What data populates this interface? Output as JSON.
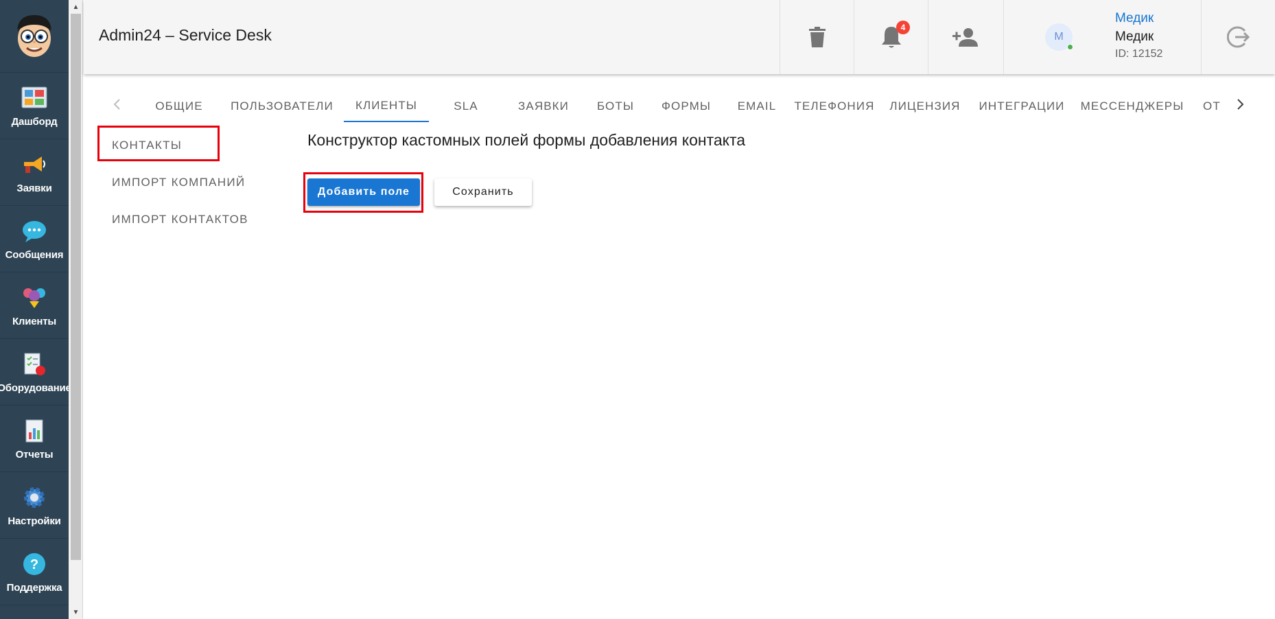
{
  "sidebar": {
    "items": [
      {
        "label": "Дашборд",
        "icon": "dashboard-icon"
      },
      {
        "label": "Заявки",
        "icon": "megaphone-icon"
      },
      {
        "label": "Сообщения",
        "icon": "chat-bubble-icon"
      },
      {
        "label": "Клиенты",
        "icon": "clients-icon"
      },
      {
        "label": "Оборудование",
        "icon": "equipment-icon"
      },
      {
        "label": "Отчеты",
        "icon": "reports-icon"
      },
      {
        "label": "Настройки",
        "icon": "gear-icon"
      },
      {
        "label": "Поддержка",
        "icon": "help-icon"
      }
    ]
  },
  "header": {
    "title": "Admin24 – Service Desk",
    "notifications_count": "4",
    "user": {
      "link": "Медик",
      "name": "Медик",
      "id": "ID: 12152",
      "avatar_letter": "М"
    }
  },
  "tabs": [
    {
      "label": "Общие"
    },
    {
      "label": "Пользователи"
    },
    {
      "label": "Клиенты"
    },
    {
      "label": "SLA"
    },
    {
      "label": "Заявки"
    },
    {
      "label": "Боты"
    },
    {
      "label": "Формы"
    },
    {
      "label": "Email"
    },
    {
      "label": "Телефония"
    },
    {
      "label": "Лицензия"
    },
    {
      "label": "Интеграции"
    },
    {
      "label": "Мессенджеры"
    },
    {
      "label": "Откр"
    }
  ],
  "subnav": [
    {
      "label": "Контакты"
    },
    {
      "label": "Импорт компаний"
    },
    {
      "label": "Импорт контактов"
    }
  ],
  "content": {
    "title": "Конструктор кастомных полей формы добавления контакта",
    "add_field_label": "Добавить поле",
    "save_label": "Сохранить"
  },
  "colors": {
    "sidebar_bg": "#2e4454",
    "accent": "#1976d2",
    "highlight_box": "#e8000b",
    "badge": "#f44336"
  }
}
